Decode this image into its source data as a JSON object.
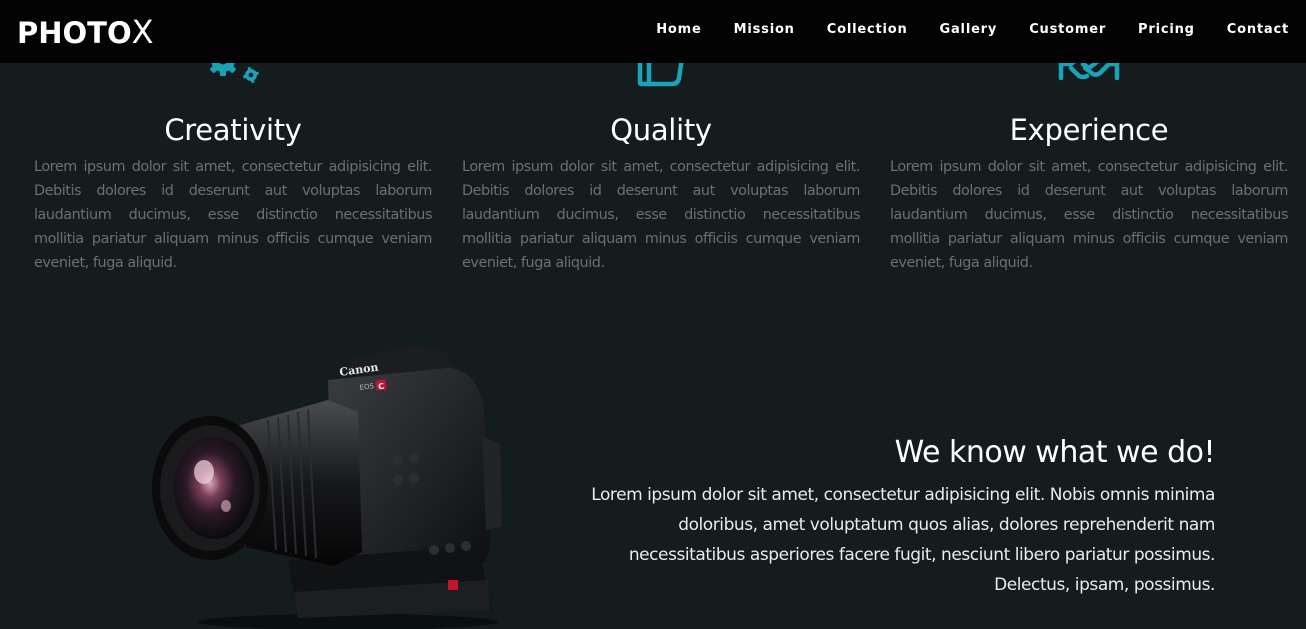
{
  "brand": {
    "main": "PHOTO",
    "accent": "X"
  },
  "nav": {
    "items": [
      {
        "label": "Home"
      },
      {
        "label": "Mission"
      },
      {
        "label": "Collection"
      },
      {
        "label": "Gallery"
      },
      {
        "label": "Customer"
      },
      {
        "label": "Pricing"
      },
      {
        "label": "Contact"
      }
    ]
  },
  "features": [
    {
      "icon": "gears-icon",
      "title": "Creativity",
      "text": "Lorem ipsum dolor sit amet, consectetur adipisicing elit. Debitis dolores id deserunt aut voluptas laborum laudantium ducimus, esse distinctio necessitatibus mollitia pariatur aliquam minus officiis cumque veniam eveniet, fuga aliquid."
    },
    {
      "icon": "thumbs-up-icon",
      "title": "Quality",
      "text": "Lorem ipsum dolor sit amet, consectetur adipisicing elit. Debitis dolores id deserunt aut voluptas laborum laudantium ducimus, esse distinctio necessitatibus mollitia pariatur aliquam minus officiis cumque veniam eveniet, fuga aliquid."
    },
    {
      "icon": "handshake-icon",
      "title": "Experience",
      "text": "Lorem ipsum dolor sit amet, consectetur adipisicing elit. Debitis dolores id deserunt aut voluptas laborum laudantium ducimus, esse distinctio necessitatibus mollitia pariatur aliquam minus officiis cumque veniam eveniet, fuga aliquid."
    }
  ],
  "about": {
    "title": "We know what we do!",
    "text": "Lorem ipsum dolor sit amet, consectetur adipisicing elit. Nobis omnis minima doloribus, amet voluptatum quos alias, dolores reprehenderit nam necessitatibus asperiores facere fugit, nesciunt libero pariatur possimus. Delectus, ipsam, possimus.",
    "image": "camera-photo",
    "camera_labels": {
      "brand": "Canon",
      "model": "EOS",
      "badge": "C"
    }
  },
  "colors": {
    "background": "#141c1e",
    "navbar": "#030303",
    "accent_icon": "#1aa3b8",
    "body_text": "#6a7172",
    "heading": "#ffffff"
  }
}
